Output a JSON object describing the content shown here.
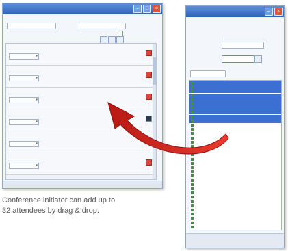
{
  "caption": {
    "line1": "Conference initiator can add up to",
    "line2": "32 attendees by drag & drop."
  },
  "left_window": {
    "attendee_rows": [
      {
        "delete_state": "red"
      },
      {
        "delete_state": "red"
      },
      {
        "delete_state": "red"
      },
      {
        "delete_state": "dark"
      },
      {
        "delete_state": "none"
      },
      {
        "delete_state": "red"
      }
    ]
  },
  "right_window": {
    "rows": [
      {
        "selected": true
      },
      {
        "selected": true
      },
      {
        "selected": true
      },
      {
        "selected": true
      },
      {
        "selected": true
      },
      {
        "selected": true
      },
      {
        "selected": true
      },
      {
        "selected": true
      },
      {
        "selected": true
      },
      {
        "selected": true
      },
      {
        "selected": false
      },
      {
        "selected": false
      },
      {
        "selected": false
      },
      {
        "selected": false
      },
      {
        "selected": false
      },
      {
        "selected": false
      },
      {
        "selected": false
      },
      {
        "selected": false
      },
      {
        "selected": false
      },
      {
        "selected": false
      },
      {
        "selected": false
      },
      {
        "selected": false
      },
      {
        "selected": false
      },
      {
        "selected": false
      },
      {
        "selected": false
      },
      {
        "selected": false
      },
      {
        "selected": false
      },
      {
        "selected": false
      },
      {
        "selected": false
      },
      {
        "selected": false
      },
      {
        "selected": false
      },
      {
        "selected": false
      },
      {
        "selected": false
      },
      {
        "selected": false
      },
      {
        "selected": false
      }
    ]
  },
  "colors": {
    "arrow": "#d6281f",
    "selection": "#3b6fd1",
    "titlebar": "#2f62b8"
  }
}
